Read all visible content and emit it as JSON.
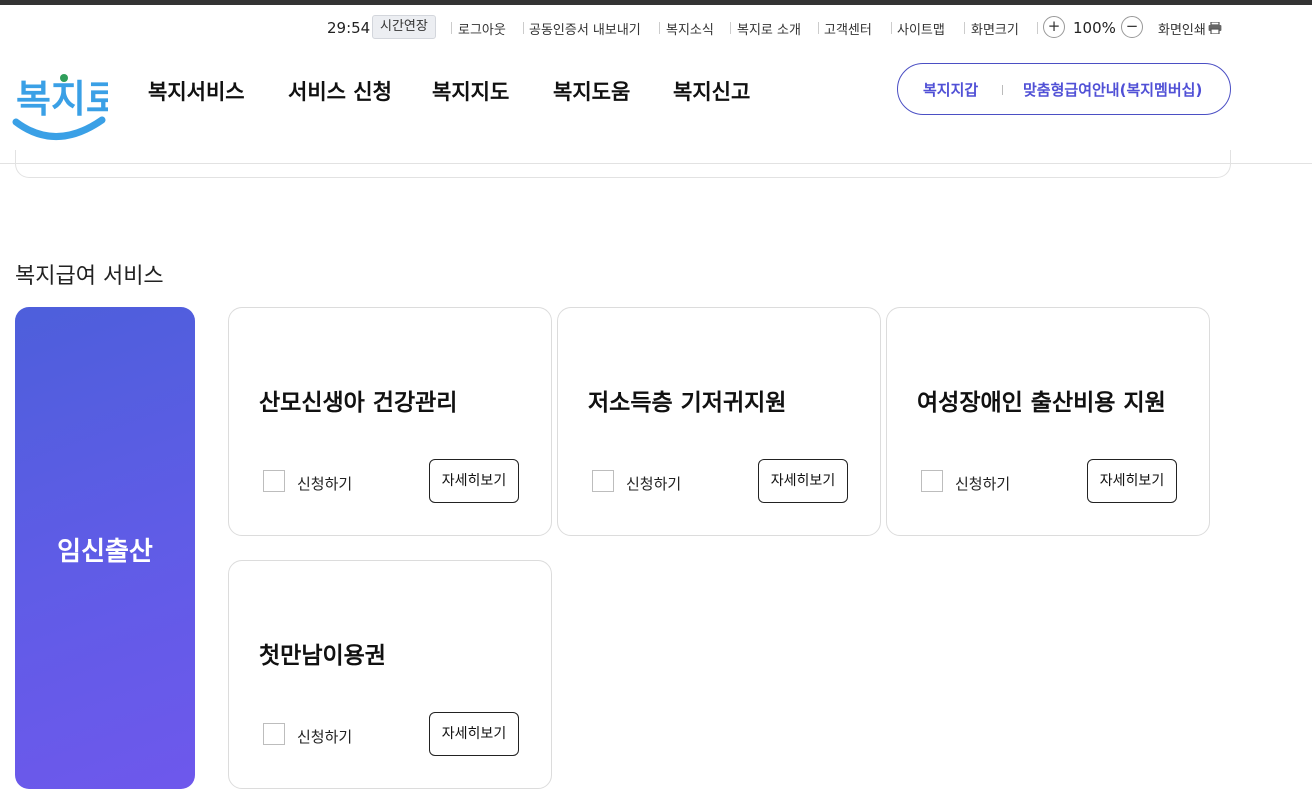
{
  "utility": {
    "timer": "29:54",
    "extend": "시간연장",
    "links": [
      "로그아웃",
      "공동인증서 내보내기",
      "복지소식",
      "복지로 소개",
      "고객센터",
      "사이트맵",
      "화면크기"
    ],
    "zoom_in": "+",
    "zoom_value": "100%",
    "zoom_out": "−",
    "print": "화면인쇄"
  },
  "header": {
    "logo_text": "복지로",
    "nav": [
      "복지서비스",
      "서비스 신청",
      "복지지도",
      "복지도움",
      "복지신고"
    ],
    "quick": [
      "복지지갑",
      "맞춤형급여안내(복지멤버십)"
    ]
  },
  "section": {
    "title": "복지급여 서비스",
    "category": "임신출산",
    "check_label": "신청하기",
    "detail_label": "자세히보기",
    "cards": [
      {
        "title": "산모신생아 건강관리"
      },
      {
        "title": "저소득층 기저귀지원"
      },
      {
        "title": "여성장애인 출산비용 지원"
      },
      {
        "title": "첫만남이용권"
      }
    ]
  },
  "colors": {
    "accent": "#5050d6",
    "category_gradient_start": "#4d5fdb",
    "category_gradient_end": "#6e58ec",
    "logo_blue": "#3aa0e6",
    "logo_green": "#2f9e5a"
  }
}
